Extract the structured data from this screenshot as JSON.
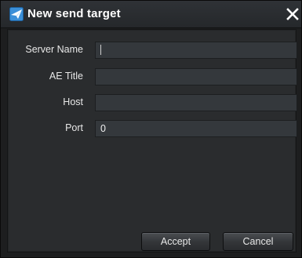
{
  "dialog": {
    "title": "New send target",
    "icons": {
      "app": "paper-plane-icon",
      "close": "close-icon"
    }
  },
  "form": {
    "fields": [
      {
        "label": "Server Name",
        "value": ""
      },
      {
        "label": "AE Title",
        "value": ""
      },
      {
        "label": "Host",
        "value": ""
      },
      {
        "label": "Port",
        "value": "0"
      }
    ]
  },
  "buttons": {
    "accept_label": "Accept",
    "cancel_label": "Cancel"
  },
  "colors": {
    "background": "#1d1e1f",
    "panel": "#2a2c2e",
    "field": "#34383c",
    "text": "#e8e8e8"
  }
}
